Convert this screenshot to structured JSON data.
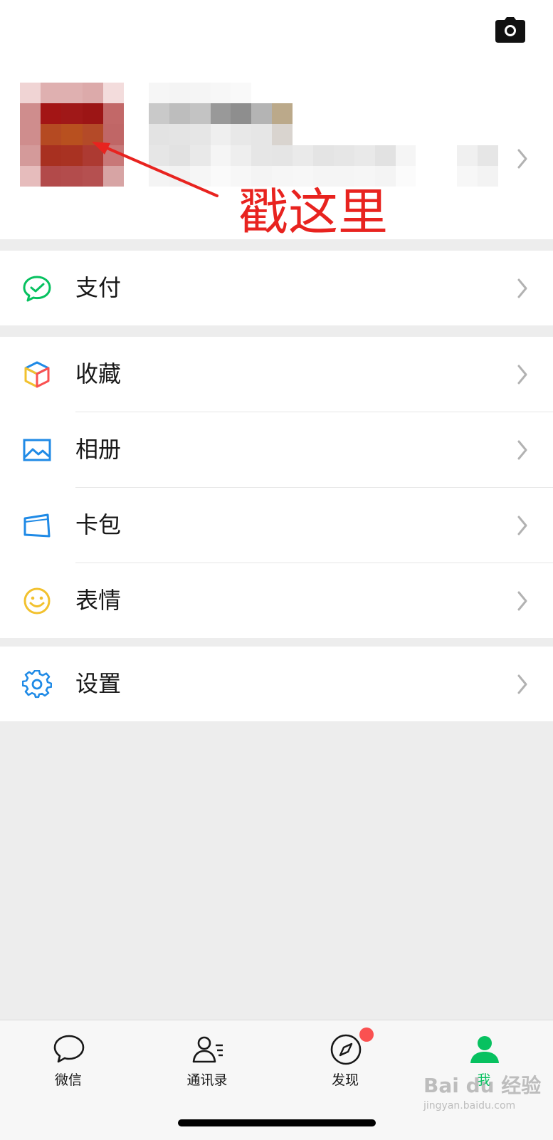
{
  "profile": {
    "annotation": "戳这里",
    "annotation_color": "#e8231f"
  },
  "header_icons": {
    "camera": "camera-icon"
  },
  "menu": {
    "pay": {
      "label": "支付",
      "icon": "wechat-pay-icon",
      "icon_color": "#07c160"
    },
    "favorites": {
      "label": "收藏",
      "icon": "cube-icon"
    },
    "album": {
      "label": "相册",
      "icon": "image-icon",
      "icon_color": "#1f8ae6"
    },
    "cards": {
      "label": "卡包",
      "icon": "card-icon",
      "icon_color": "#1f8ae6"
    },
    "stickers": {
      "label": "表情",
      "icon": "smiley-icon",
      "icon_color": "#f2c12e"
    },
    "settings": {
      "label": "设置",
      "icon": "gear-icon",
      "icon_color": "#1f8ae6"
    }
  },
  "tabbar": {
    "items": [
      {
        "label": "微信",
        "icon": "chat-bubble-icon"
      },
      {
        "label": "通讯录",
        "icon": "contacts-icon"
      },
      {
        "label": "发现",
        "icon": "compass-icon",
        "badge": true
      },
      {
        "label": "我",
        "icon": "person-icon",
        "active": true
      }
    ],
    "active_color": "#07c160",
    "badge_color": "#fa5151"
  },
  "watermark": {
    "main": "Bai du 经验",
    "sub": "jingyan.baidu.com"
  }
}
